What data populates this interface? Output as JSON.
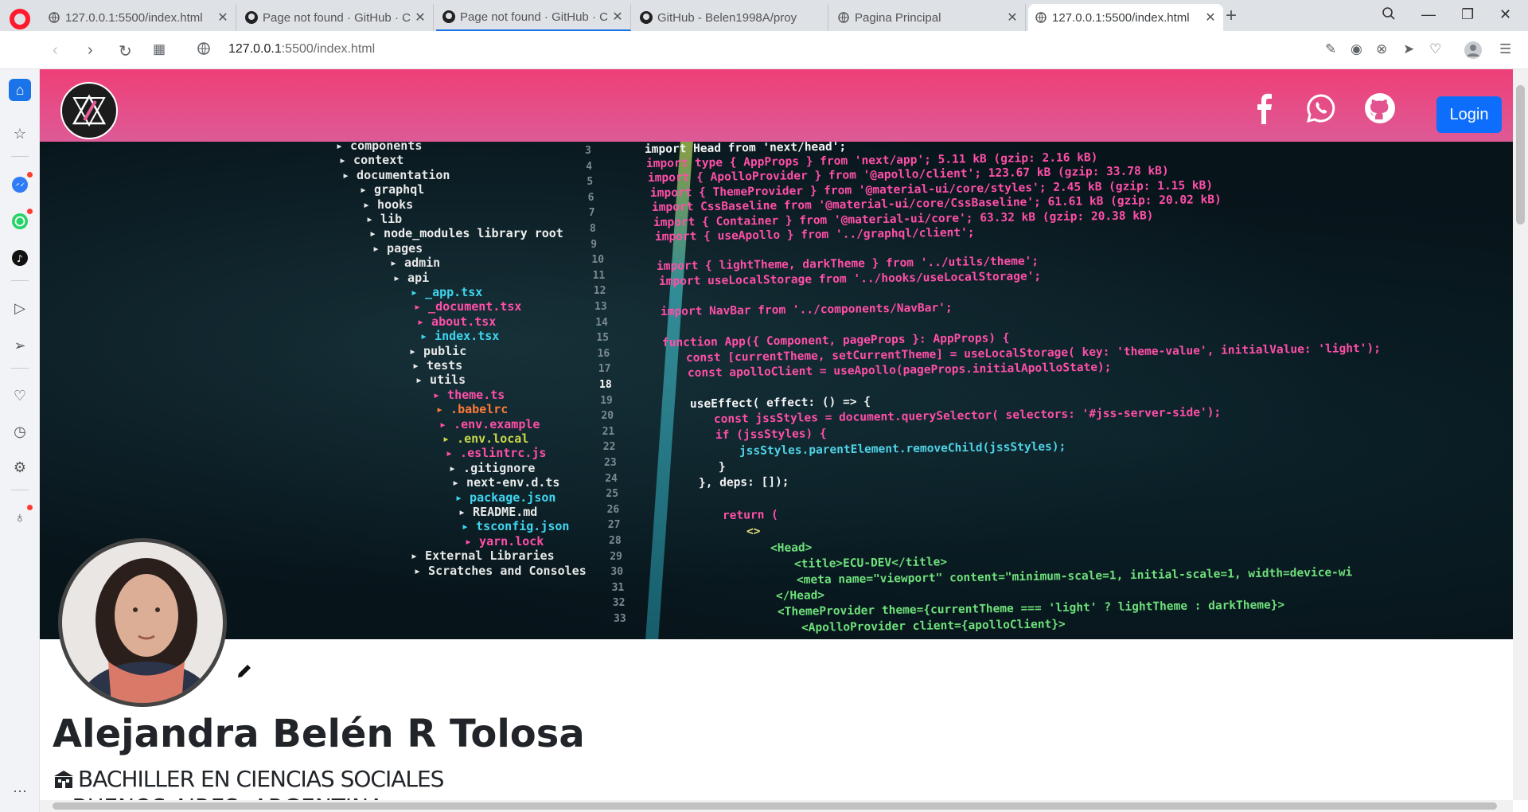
{
  "browser": {
    "tabs": [
      {
        "title": "127.0.0.1:5500/index.html",
        "icon": "globe-icon"
      },
      {
        "title": "Page not found · GitHub · C",
        "icon": "github-icon"
      },
      {
        "title": "Page not found · GitHub · C",
        "icon": "github-icon"
      },
      {
        "title": "GitHub - Belen1998A/proy",
        "icon": "github-icon"
      },
      {
        "title": "Pagina Principal",
        "icon": "globe-icon"
      },
      {
        "title": "127.0.0.1:5500/index.html",
        "icon": "globe-icon"
      }
    ],
    "url_host": "127.0.0.1",
    "url_rest": ":5500/index.html"
  },
  "navbar": {
    "login_label": "Login",
    "accent": "#0d6efd",
    "gradient_from": "#ef3f77",
    "gradient_to": "#dd5a96"
  },
  "banner": {
    "tree": [
      "components",
      "context",
      "documentation",
      "graphql",
      "hooks",
      "lib",
      "node_modules library root",
      "pages",
      "admin",
      "api",
      "_app.tsx",
      "_document.tsx",
      "about.tsx",
      "index.tsx",
      "public",
      "tests",
      "utils",
      "theme.ts",
      ".babelrc",
      ".env.example",
      ".env.local",
      ".eslintrc.js",
      ".gitignore",
      "next-env.d.ts",
      "package.json",
      "README.md",
      "tsconfig.json",
      "yarn.lock",
      "External Libraries",
      "Scratches and Consoles"
    ],
    "line_numbers": [
      "3",
      "4",
      "5",
      "6",
      "7",
      "8",
      "9",
      "10",
      "11",
      "12",
      "13",
      "14",
      "15",
      "16",
      "17",
      "18",
      "19",
      "20",
      "21",
      "22",
      "23",
      "24",
      "25",
      "26",
      "27",
      "28",
      "29",
      "30",
      "31",
      "32",
      "33"
    ],
    "code": [
      "import Head from 'next/head';",
      "import type { AppProps } from 'next/app';  5.11 kB (gzip: 2.16 kB)",
      "import { ApolloProvider } from '@apollo/client';  123.67 kB (gzip: 33.78 kB)",
      "import { ThemeProvider } from '@material-ui/core/styles';  2.45 kB (gzip: 1.15 kB)",
      "import CssBaseline from '@material-ui/core/CssBaseline';  61.61 kB (gzip: 20.02 kB)",
      "import { Container } from '@material-ui/core';  63.32 kB (gzip: 20.38 kB)",
      "import { useApollo } from '../graphql/client';",
      "import { lightTheme, darkTheme } from '../utils/theme';",
      "import useLocalStorage from '../hooks/useLocalStorage';",
      "import NavBar from '../components/NavBar';",
      "function App({ Component, pageProps }: AppProps) {",
      "const [currentTheme, setCurrentTheme] = useLocalStorage( key: 'theme-value', initialValue: 'light');",
      "const apolloClient = useApollo(pageProps.initialApolloState);",
      "useEffect( effect: () => {",
      "const jssStyles = document.querySelector( selectors: '#jss-server-side');",
      "if (jssStyles) {",
      "jssStyles.parentElement.removeChild(jssStyles);",
      "}",
      "},  deps: []);",
      "return (",
      "<>",
      "<Head>",
      "<title>ECU-DEV</title>",
      "<meta name=\"viewport\" content=\"minimum-scale=1, initial-scale=1, width=device-wi",
      "</Head>",
      "<ThemeProvider theme={currentTheme === 'light' ? lightTheme : darkTheme}>",
      "<ApolloProvider client={apolloClient}>"
    ]
  },
  "profile": {
    "name": "Alejandra Belén R Tolosa",
    "degree": "BACHILLER EN CIENCIAS SOCIALES",
    "location": "BUENOS AIRES, ARGENTINA"
  }
}
